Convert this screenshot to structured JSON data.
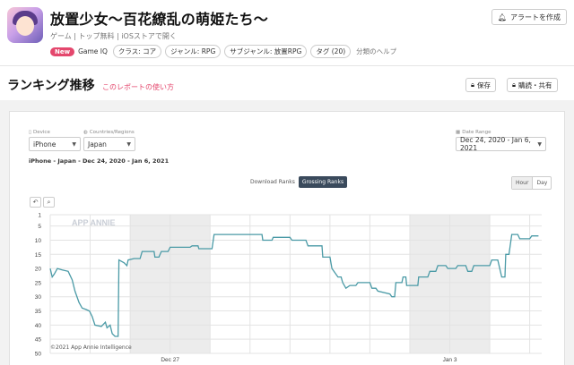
{
  "header": {
    "title": "放置少女～百花繚乱の萌姫たち～",
    "subtitle": "ゲーム | トップ無料 | iOSストアで開く",
    "new_badge": "New",
    "game_iq": "Game IQ",
    "chips": [
      "クラス: コア",
      "ジャンル: RPG",
      "サブジャンル: 放置RPG",
      "タグ (20)"
    ],
    "help": "分類のヘルプ",
    "alert_button": "アラートを作成"
  },
  "section": {
    "title": "ランキング推移",
    "link": "このレポートの使い方",
    "save_button": "保存",
    "share_button": "購読・共有"
  },
  "filters": {
    "device_label": "Device",
    "device_value": "iPhone",
    "country_label": "Countries/Regions",
    "country_value": "Japan",
    "date_label": "Date Range",
    "date_value": "Dec 24, 2020 - Jan 6, 2021",
    "summary": "iPhone - Japan - Dec 24, 2020 - Jan 6, 2021"
  },
  "toggles": {
    "download": "Download Ranks",
    "grossing": "Grossing Ranks",
    "hour": "Hour",
    "day": "Day"
  },
  "watermark": "APP ANNIE",
  "copyright": "©2021 App Annie Intelligence",
  "colors": {
    "accent": "#e4476d",
    "line": "#4a9aa6"
  },
  "chart_data": {
    "type": "line",
    "series": [
      {
        "points": [
          [
            24.0,
            20
          ],
          [
            24.05,
            23
          ],
          [
            24.1,
            22
          ],
          [
            24.18,
            20
          ],
          [
            24.3,
            20.5
          ],
          [
            24.45,
            21
          ],
          [
            24.55,
            24
          ],
          [
            24.62,
            28
          ],
          [
            24.72,
            32
          ],
          [
            24.8,
            34
          ],
          [
            24.9,
            34.5
          ],
          [
            24.98,
            35
          ],
          [
            25.05,
            37
          ],
          [
            25.12,
            40
          ],
          [
            25.28,
            40.5
          ],
          [
            25.38,
            39
          ],
          [
            25.42,
            41
          ],
          [
            25.5,
            40
          ],
          [
            25.55,
            43
          ],
          [
            25.62,
            44
          ],
          [
            25.7,
            44
          ],
          [
            25.72,
            17
          ],
          [
            25.85,
            18
          ],
          [
            25.92,
            19
          ],
          [
            25.95,
            17
          ],
          [
            26.1,
            16.5
          ],
          [
            26.25,
            16.5
          ],
          [
            26.3,
            14
          ],
          [
            26.6,
            14
          ],
          [
            26.62,
            16
          ],
          [
            26.72,
            16
          ],
          [
            26.78,
            14
          ],
          [
            26.95,
            14
          ],
          [
            27.0,
            12.5
          ],
          [
            27.5,
            12.5
          ],
          [
            27.55,
            12
          ],
          [
            27.7,
            12
          ],
          [
            27.72,
            13
          ],
          [
            27.9,
            13
          ],
          [
            28.05,
            13
          ],
          [
            28.1,
            8
          ],
          [
            28.3,
            8
          ],
          [
            28.6,
            8
          ],
          [
            28.9,
            8
          ],
          [
            29.0,
            8
          ],
          [
            29.3,
            8
          ],
          [
            29.32,
            10
          ],
          [
            29.55,
            10
          ],
          [
            29.58,
            9
          ],
          [
            29.95,
            9
          ],
          [
            30.0,
            9
          ],
          [
            30.05,
            10
          ],
          [
            30.4,
            10
          ],
          [
            30.45,
            12
          ],
          [
            30.8,
            12
          ],
          [
            30.82,
            16
          ],
          [
            31.0,
            16
          ],
          [
            31.05,
            20
          ],
          [
            31.2,
            23
          ],
          [
            31.28,
            23
          ],
          [
            31.32,
            25
          ],
          [
            31.4,
            27
          ],
          [
            31.5,
            26
          ],
          [
            31.65,
            26
          ],
          [
            31.7,
            25
          ],
          [
            32.0,
            25
          ],
          [
            32.05,
            27
          ],
          [
            32.15,
            27
          ],
          [
            32.2,
            28
          ],
          [
            32.5,
            29
          ],
          [
            32.55,
            30
          ],
          [
            32.62,
            30
          ],
          [
            32.65,
            25
          ],
          [
            32.8,
            25
          ],
          [
            32.83,
            23
          ],
          [
            32.9,
            23
          ],
          [
            32.92,
            26
          ],
          [
            33.2,
            26
          ],
          [
            33.22,
            23
          ],
          [
            33.45,
            23
          ],
          [
            33.5,
            21
          ],
          [
            33.65,
            21
          ],
          [
            33.7,
            19
          ],
          [
            33.9,
            19
          ],
          [
            33.95,
            20
          ],
          [
            34.15,
            20
          ],
          [
            34.2,
            19
          ],
          [
            34.4,
            19
          ],
          [
            34.45,
            21
          ],
          [
            34.55,
            21
          ],
          [
            34.6,
            19
          ],
          [
            34.9,
            19
          ],
          [
            35.0,
            19
          ],
          [
            35.05,
            17
          ],
          [
            35.2,
            17
          ],
          [
            35.25,
            20
          ],
          [
            35.3,
            23
          ],
          [
            35.38,
            23
          ],
          [
            35.4,
            15
          ],
          [
            35.48,
            15
          ],
          [
            35.55,
            8
          ],
          [
            35.7,
            8
          ],
          [
            35.75,
            9.5
          ],
          [
            35.95,
            9.5
          ],
          [
            36.0,
            9.5
          ],
          [
            36.05,
            8.5
          ],
          [
            36.15,
            8.5
          ],
          [
            36.22,
            8.5
          ]
        ]
      }
    ],
    "x_ticks": [
      {
        "x": 27,
        "label": "Dec 27"
      },
      {
        "x": 34,
        "label": "Jan 3"
      }
    ],
    "x_range": [
      24,
      36.3
    ],
    "y_ticks": [
      1,
      5,
      10,
      15,
      20,
      25,
      30,
      35,
      40,
      45,
      50
    ],
    "y_range": [
      1,
      50
    ],
    "y_inverted": true,
    "weekend_bands": [
      [
        26,
        28
      ],
      [
        33,
        35
      ]
    ],
    "grid": true
  }
}
